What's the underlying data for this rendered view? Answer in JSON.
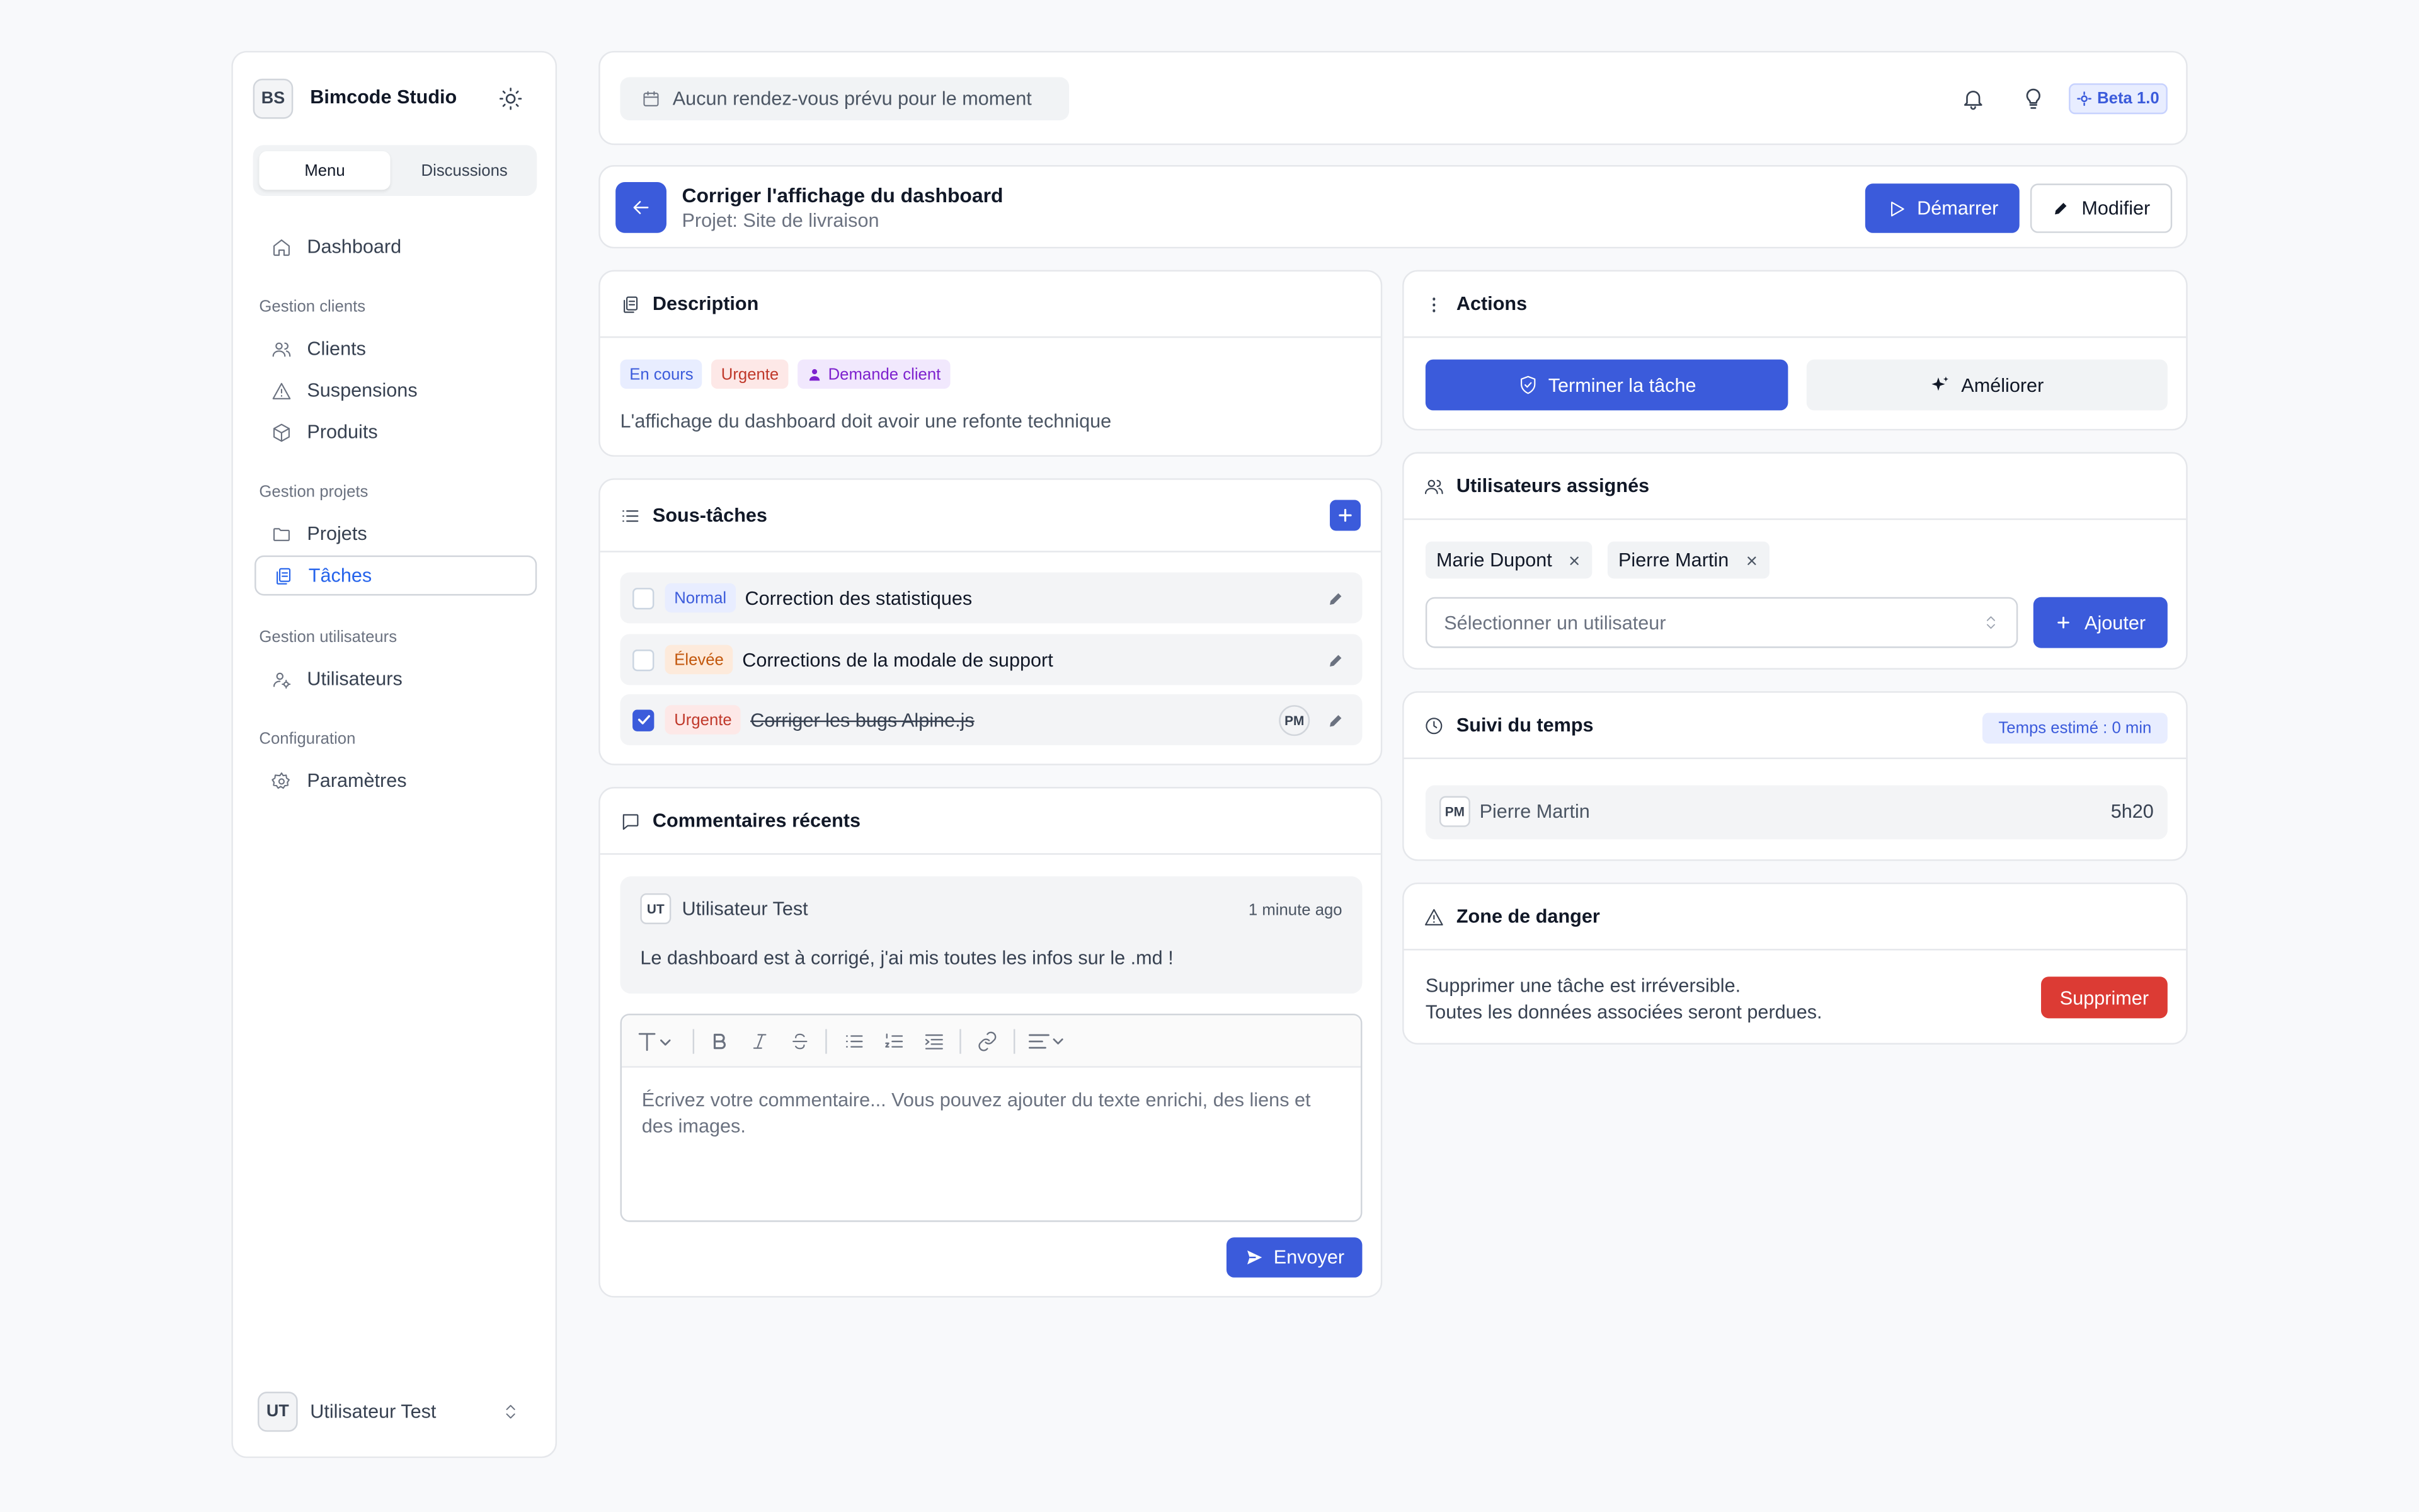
{
  "sidebar": {
    "brand_initials": "BS",
    "brand_name": "Bimcode Studio",
    "tabs": [
      "Menu",
      "Discussions"
    ],
    "dashboard": "Dashboard",
    "groups": {
      "clients": "Gestion clients",
      "projects": "Gestion projets",
      "users": "Gestion utilisateurs",
      "config": "Configuration"
    },
    "items": {
      "clients": "Clients",
      "suspensions": "Suspensions",
      "produits": "Produits",
      "projets": "Projets",
      "taches": "Tâches",
      "utilisateurs": "Utilisateurs",
      "parametres": "Paramètres"
    },
    "user_initials": "UT",
    "user_name": "Utilisateur Test"
  },
  "topbar": {
    "appointments": "Aucun rendez-vous prévu pour le moment",
    "beta_label": "Beta 1.0"
  },
  "task": {
    "title": "Corriger l'affichage du dashboard",
    "project": "Projet: Site de livraison",
    "start_label": "Démarrer",
    "edit_label": "Modifier"
  },
  "description": {
    "heading": "Description",
    "tags": {
      "status": "En cours",
      "priority": "Urgente",
      "type": "Demande client"
    },
    "text": "L'affichage du dashboard doit avoir une refonte technique"
  },
  "subtasks": {
    "heading": "Sous-tâches",
    "items": [
      {
        "priority": "Normal",
        "title": "Correction des statistiques",
        "done": false
      },
      {
        "priority": "Élevée",
        "title": "Corrections de la modale de support",
        "done": false
      },
      {
        "priority": "Urgente",
        "title": "Corriger les bugs Alpine.js",
        "done": true,
        "assignee": "PM"
      }
    ]
  },
  "comments": {
    "heading": "Commentaires récents",
    "items": [
      {
        "initials": "UT",
        "author": "Utilisateur Test",
        "time": "1 minute ago",
        "text": "Le dashboard est à corrigé, j'ai mis toutes les infos sur le .md !"
      }
    ],
    "placeholder": "Écrivez votre commentaire... Vous pouvez ajouter du texte enrichi, des liens et des images.",
    "send_label": "Envoyer"
  },
  "actions": {
    "heading": "Actions",
    "finish_label": "Terminer la tâche",
    "improve_label": "Améliorer"
  },
  "assigned": {
    "heading": "Utilisateurs assignés",
    "users": [
      "Marie Dupont",
      "Pierre Martin"
    ],
    "select_placeholder": "Sélectionner un utilisateur",
    "add_label": "Ajouter"
  },
  "time": {
    "heading": "Suivi du temps",
    "estimate": "Temps estimé : 0 min",
    "entries": [
      {
        "initials": "PM",
        "name": "Pierre Martin",
        "duration": "5h20"
      }
    ]
  },
  "danger": {
    "heading": "Zone de danger",
    "line1": "Supprimer une tâche est irréversible.",
    "line2": "Toutes les données associées seront perdues.",
    "delete_label": "Supprimer"
  },
  "colors": {
    "accent": "#3b5bdb",
    "danger": "#dc3b34"
  }
}
